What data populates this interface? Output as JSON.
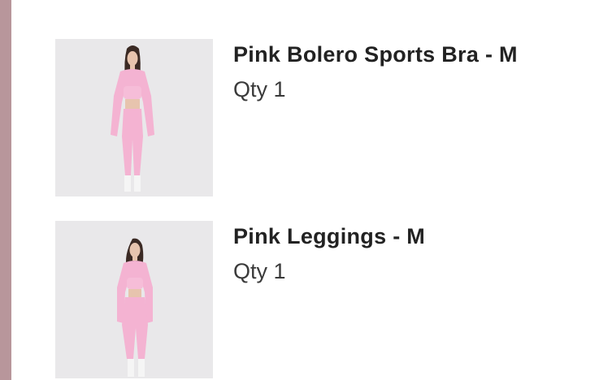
{
  "colors": {
    "sidebar_accent": "#b8969b",
    "thumb_bg": "#e9e8ea",
    "garment_pink": "#f4b3d2"
  },
  "items": [
    {
      "title": "Pink Bolero Sports Bra - M",
      "qty": "Qty 1",
      "image_icon": "product-photo"
    },
    {
      "title": "Pink Leggings - M",
      "qty": "Qty 1",
      "image_icon": "product-photo"
    }
  ]
}
